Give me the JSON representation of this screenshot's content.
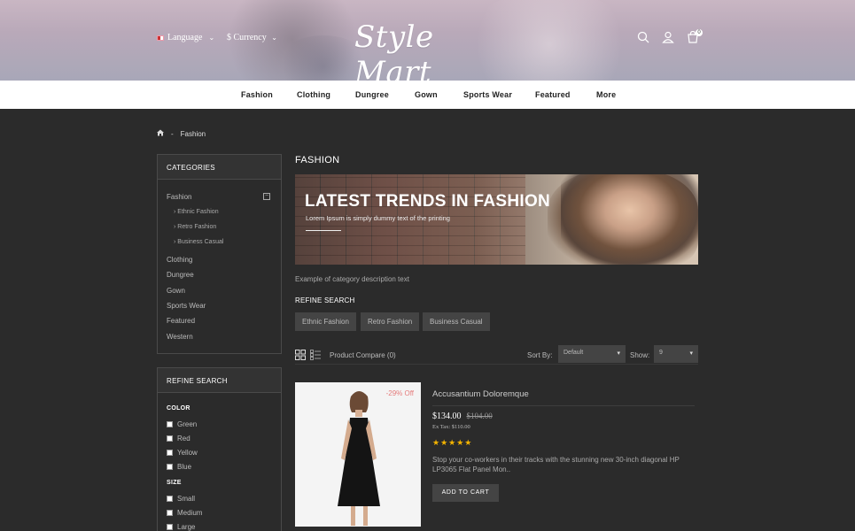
{
  "header": {
    "language_label": "Language",
    "currency_label": "$ Currency",
    "logo_text": "Style Mart",
    "cart_count": "0"
  },
  "nav": {
    "items": [
      "Fashion",
      "Clothing",
      "Dungree",
      "Gown",
      "Sports Wear",
      "Featured",
      "More"
    ]
  },
  "breadcrumb": {
    "current": "Fashion"
  },
  "sidebar": {
    "categories_title": "CATEGORIES",
    "categories": [
      "Fashion",
      "Clothing",
      "Dungree",
      "Gown",
      "Sports Wear",
      "Featured",
      "Western"
    ],
    "subcategories": [
      "Ethnic Fashion",
      "Retro Fashion",
      "Business Casual"
    ],
    "refine_title": "REFINE SEARCH",
    "color_label": "COLOR",
    "colors": [
      "Green",
      "Red",
      "Yellow",
      "Blue"
    ],
    "size_label": "SIZE",
    "sizes": [
      "Small",
      "Medium",
      "Large"
    ]
  },
  "main": {
    "title": "FASHION",
    "banner_title": "LATEST TRENDS IN FASHION",
    "banner_subtitle": "Lorem Ipsum is simply dummy text of the printing",
    "description": "Example of category description text",
    "refine_heading": "REFINE SEARCH",
    "refine_chips": [
      "Ethnic Fashion",
      "Retro Fashion",
      "Business Casual"
    ],
    "product_compare": "Product Compare (0)",
    "sort_label": "Sort By:",
    "sort_value": "Default",
    "show_label": "Show:",
    "show_value": "9"
  },
  "product": {
    "discount": "-29% Off",
    "name": "Accusantium Doloremque",
    "price": "$134.00",
    "old_price": "$104.00",
    "ex_tax": "Ex Tax: $110.00",
    "rating": 5,
    "rating_stars": "★★★★★",
    "description": "Stop your co-workers in their tracks with the stunning new 30-inch diagonal HP LP3065 Flat Panel Mon..",
    "add_to_cart": "ADD TO CART"
  }
}
